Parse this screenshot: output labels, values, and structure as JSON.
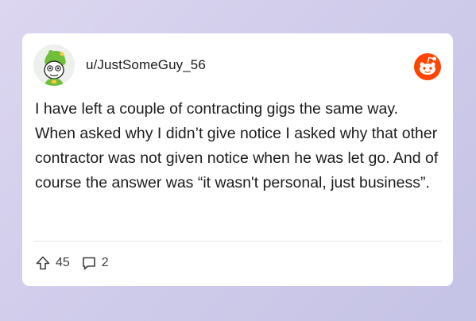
{
  "post": {
    "username": "u/JustSomeGuy_56",
    "body": "I have left a couple of contracting gigs the same way. When asked why I didn’t give notice I asked why that other contractor was not given notice when he was let go. And of course the answer was “it wasn't personal, just business”.",
    "upvotes": "45",
    "comments": "2"
  },
  "icons": {
    "logo": "reddit-logo-icon",
    "upvote": "upvote-arrow-icon",
    "comment": "comment-bubble-icon"
  },
  "colors": {
    "accent": "#ff4500",
    "text": "#1c1c1c"
  }
}
